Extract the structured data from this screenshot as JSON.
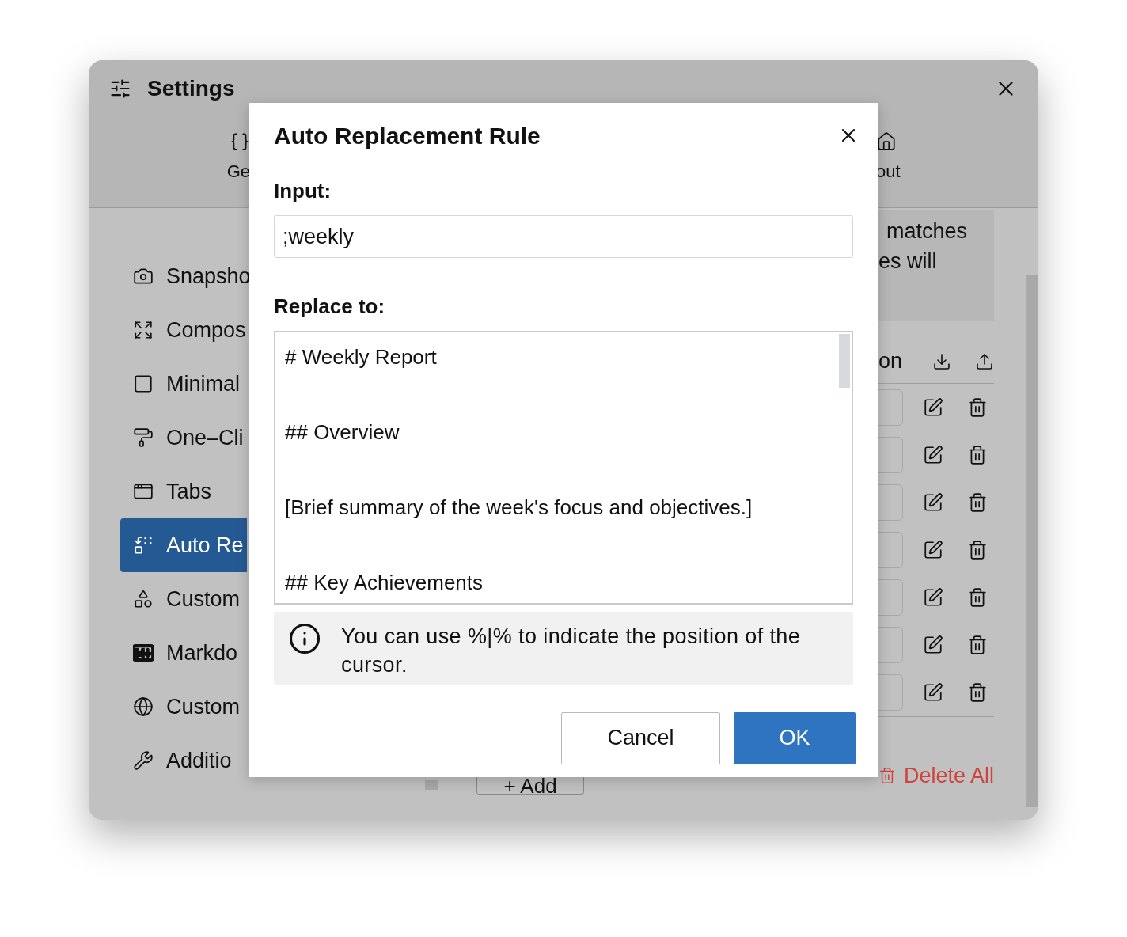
{
  "window": {
    "title": "Settings"
  },
  "tabs": [
    {
      "label": "Ge",
      "kind": "braces"
    },
    {
      "label": "out",
      "kind": "house"
    }
  ],
  "sidebar": {
    "items": [
      {
        "label": "Snapsho",
        "selected": false
      },
      {
        "label": "Compos",
        "selected": false
      },
      {
        "label": "Minimal",
        "selected": false
      },
      {
        "label": "One–Cli",
        "selected": false
      },
      {
        "label": "Tabs",
        "selected": false
      },
      {
        "label": "Auto Re",
        "selected": true
      },
      {
        "label": "Custom",
        "selected": false
      },
      {
        "label": "Markdo",
        "selected": false
      },
      {
        "label": "Custom",
        "selected": false
      },
      {
        "label": "Additio",
        "selected": false
      }
    ]
  },
  "description": {
    "lines": [
      "matches",
      "es will"
    ]
  },
  "rules_table": {
    "header": "on",
    "rows": [
      {
        "kind": "rule"
      },
      {
        "kind": "rule"
      },
      {
        "kind": "rule"
      },
      {
        "kind": "rule"
      },
      {
        "kind": "rule"
      },
      {
        "kind": "rule"
      },
      {
        "kind": "rule"
      }
    ]
  },
  "footer": {
    "add_button": "+ Add",
    "delete_all": "Delete All"
  },
  "dialog": {
    "title": "Auto Replacement Rule",
    "input_label": "Input:",
    "input_value": ";weekly",
    "replace_label": "Replace to:",
    "replace_value": "# Weekly Report\n\n## Overview\n\n[Brief summary of the week's focus and objectives.]\n\n## Key Achievements",
    "hint": "You can use %|% to indicate the position of the cursor.",
    "buttons": [
      {
        "label": "Cancel",
        "kind": "secondary"
      },
      {
        "label": "OK",
        "kind": "primary"
      }
    ]
  }
}
